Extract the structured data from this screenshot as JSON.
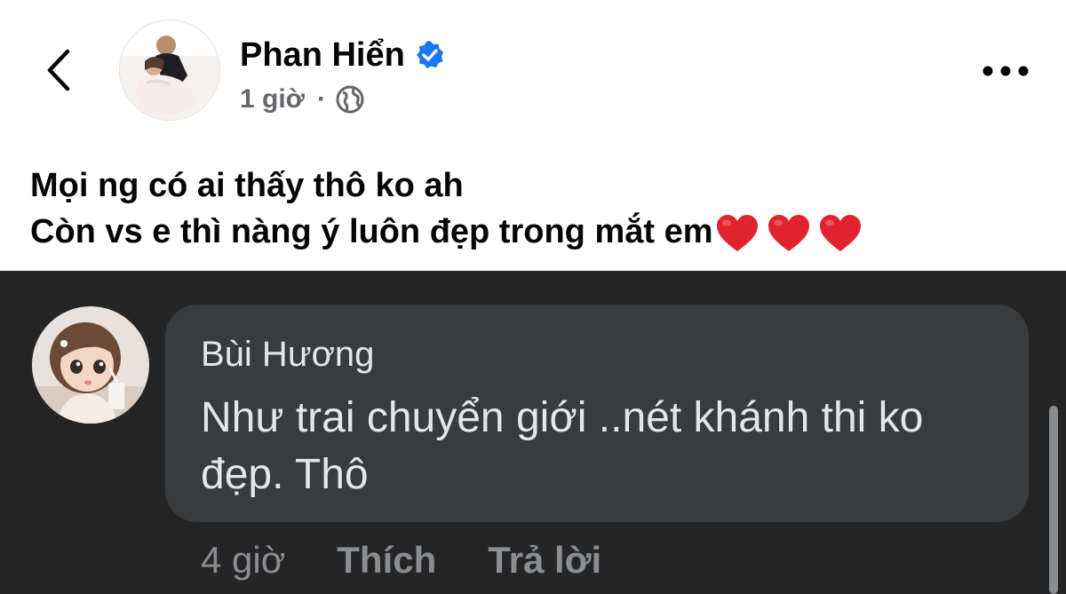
{
  "post": {
    "author_name": "Phan Hiển",
    "time": "1 giờ",
    "separator": "·",
    "lines": [
      "Mọi ng có ai thấy thô ko ah",
      "Còn vs e thì nàng ý luôn đẹp trong mắt em"
    ],
    "heart_count": 3,
    "icons": {
      "back": "chevron-left-icon",
      "verified": "verified-badge-icon",
      "privacy": "globe-icon",
      "more": "more-dots-icon",
      "heart": "red-heart-emoji"
    }
  },
  "comment": {
    "author_name": "Bùi Hương",
    "text": "Như trai chuyển giới ..nét khánh thi ko đẹp. Thô",
    "time": "4 giờ",
    "like_label": "Thích",
    "reply_label": "Trả lời"
  },
  "colors": {
    "post_bg": "#ffffff",
    "comment_panel_bg": "#252526",
    "bubble_bg": "#3a3b3c",
    "verified_blue": "#1877f2",
    "heart_red": "#e0242f",
    "muted_text": "#8a8d91"
  }
}
